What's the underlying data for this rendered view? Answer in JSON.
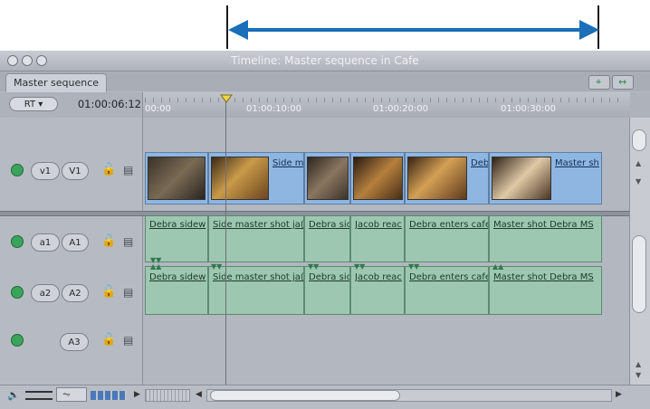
{
  "window": {
    "title": "Timeline: Master sequence in Cafe",
    "tab_label": "Master sequence"
  },
  "toolbar": {
    "rt_label": "RT ▾",
    "timecode": "01:00:06:12"
  },
  "ruler": {
    "labels": [
      "00:00",
      "01:00:10:00",
      "01:00:20:00",
      "01:00:30:00"
    ]
  },
  "tracks": {
    "video": {
      "source": "v1",
      "dest": "V1"
    },
    "audio": [
      {
        "source": "a1",
        "dest": "A1"
      },
      {
        "source": "a2",
        "dest": "A2"
      },
      {
        "source": "",
        "dest": "A3"
      }
    ]
  },
  "clips": {
    "video": [
      {
        "name": ""
      },
      {
        "name": "Side m"
      },
      {
        "name": ""
      },
      {
        "name": ""
      },
      {
        "name": "Deb"
      },
      {
        "name": "Master sh"
      }
    ],
    "audio": [
      "Debra sidew",
      "Side master shot ja(",
      "Debra sic",
      "Jacob reac",
      "Debra enters cafe",
      "Master shot Debra MS"
    ]
  },
  "colors": {
    "annotation_arrow": "#1a6fb8",
    "video_clip": "#8fb6e0",
    "audio_clip": "#9dc7b0",
    "playhead": "#f2d544"
  }
}
